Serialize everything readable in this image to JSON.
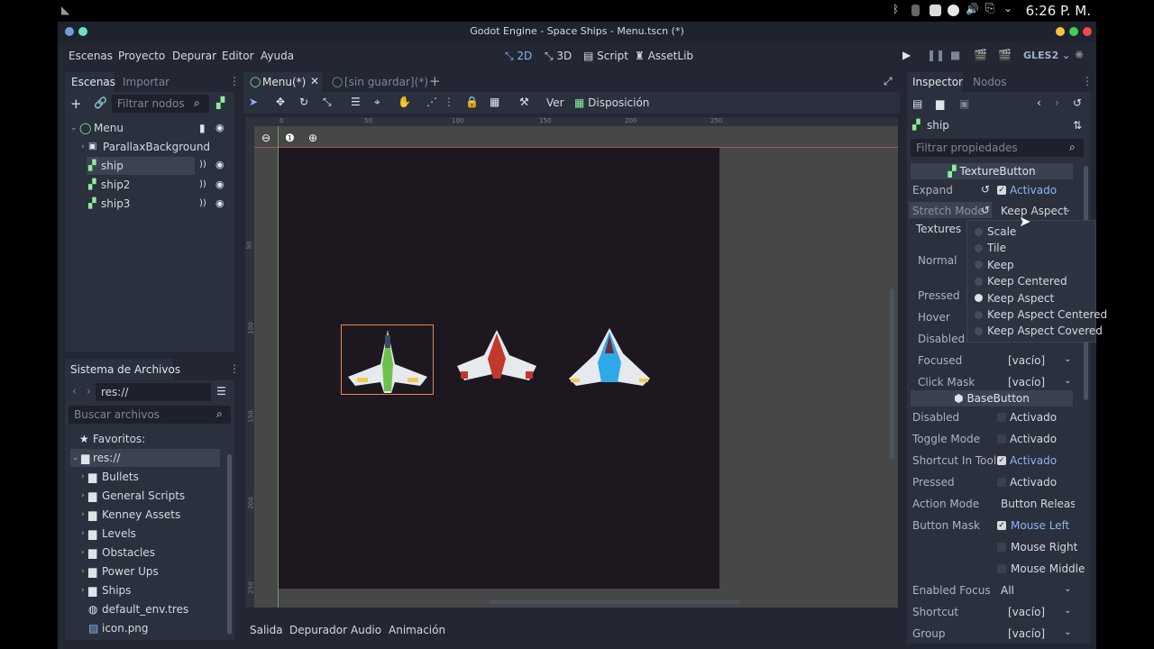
{
  "os": {
    "clock": "6:26 P. M."
  },
  "window": {
    "title": "Godot Engine - Space Ships - Menu.tscn (*)"
  },
  "menubar": {
    "items": [
      "Escenas",
      "Proyecto",
      "Depurar",
      "Editor",
      "Ayuda"
    ],
    "modes": [
      "2D",
      "3D",
      "Script",
      "AssetLib"
    ],
    "renderer": "GLES2"
  },
  "scene_dock": {
    "tabs": [
      "Escenas",
      "Importar"
    ],
    "filter_placeholder": "Filtrar nodos",
    "root": "Menu",
    "nodes": [
      "ParallaxBackground",
      "ship",
      "ship2",
      "ship3"
    ]
  },
  "fs_dock": {
    "title": "Sistema de Archivos",
    "path": "res://",
    "search_placeholder": "Buscar archivos",
    "favorites": "Favoritos:",
    "root": "res://",
    "items": [
      "Bullets",
      "General Scripts",
      "Kenney Assets",
      "Levels",
      "Obstacles",
      "Power Ups",
      "Ships",
      "default_env.tres",
      "icon.png"
    ]
  },
  "editor_tabs": [
    "Menu(*)",
    "[sin guardar](*)"
  ],
  "toolbar": {
    "view": "Ver",
    "layout": "Disposición"
  },
  "ruler": {
    "h": [
      "0",
      "50",
      "100",
      "150",
      "200",
      "250"
    ],
    "v": [
      "50",
      "100",
      "150",
      "200",
      "250"
    ]
  },
  "bottom_tabs": [
    "Salida",
    "Depurador",
    "Audio",
    "Animación"
  ],
  "inspector": {
    "tabs": [
      "Inspector",
      "Nodos"
    ],
    "node": "ship",
    "filter_placeholder": "Filtrar propiedades",
    "section1": "TextureButton",
    "expand_label": "Expand",
    "expand_value": "Activado",
    "stretch_label": "Stretch Mode",
    "stretch_value": "Keep Aspect",
    "textures_label": "Textures",
    "tex_props": [
      "Normal",
      "Pressed",
      "Hover",
      "Disabled",
      "Focused",
      "Click Mask"
    ],
    "focused_value": "[vacío]",
    "clickmask_value": "[vacío]",
    "section2": "BaseButton",
    "base_props": [
      {
        "label": "Disabled",
        "value": "Activado",
        "on": false
      },
      {
        "label": "Toggle Mode",
        "value": "Activado",
        "on": false
      },
      {
        "label": "Shortcut In Tool",
        "value": "Activado",
        "on": true
      },
      {
        "label": "Pressed",
        "value": "Activado",
        "on": false
      }
    ],
    "action_mode_label": "Action Mode",
    "action_mode_value": "Button Release",
    "button_mask_label": "Button Mask",
    "mask_values": [
      "Mouse Left",
      "Mouse Right",
      "Mouse Middle"
    ],
    "enabled_focus_label": "Enabled Focus",
    "enabled_focus_value": "All",
    "shortcut_label": "Shortcut",
    "shortcut_value": "[vacío]",
    "group_label": "Group",
    "group_value": "[vacío]"
  },
  "stretch_popup": {
    "options": [
      "Scale",
      "Tile",
      "Keep",
      "Keep Centered",
      "Keep Aspect",
      "Keep Aspect Centered",
      "Keep Aspect Covered"
    ],
    "selected": "Keep Aspect"
  },
  "colors": {
    "accent": "#8cb4f2",
    "green": "#8eef97",
    "bg": "#222733",
    "panel": "#2a303d"
  }
}
